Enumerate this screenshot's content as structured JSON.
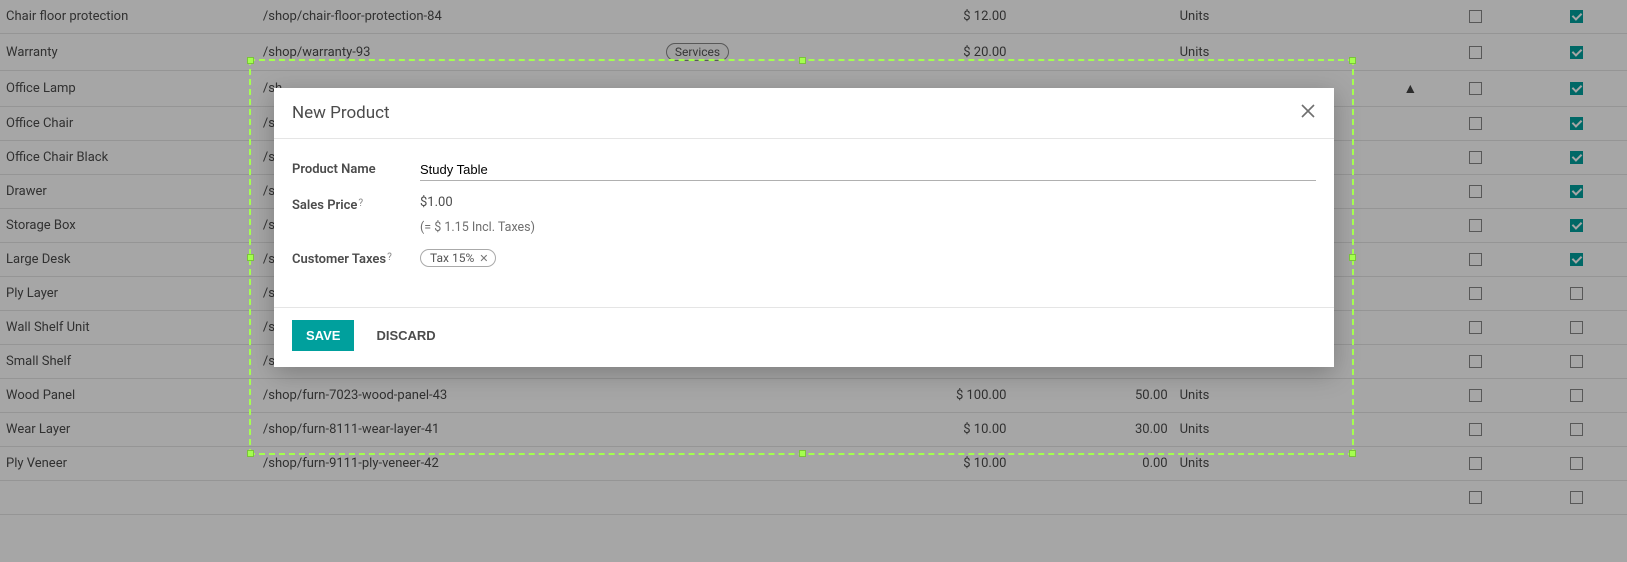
{
  "modal": {
    "title": "New Product",
    "fields": {
      "product_name_label": "Product Name",
      "product_name_value": "Study Table",
      "sales_price_label": "Sales Price",
      "sales_price_value": "$1.00",
      "sales_price_incl": "(= $ 1.15 Incl. Taxes)",
      "customer_taxes_label": "Customer Taxes",
      "tax_tag": "Tax 15%"
    },
    "buttons": {
      "save": "SAVE",
      "discard": "DISCARD"
    }
  },
  "table": {
    "rows": [
      {
        "name": "Chair floor protection",
        "url": "/shop/chair-floor-protection-84",
        "tag": "",
        "price": "$ 12.00",
        "qty": "",
        "units": "Units",
        "warn": false,
        "cb1": false,
        "cb2": true
      },
      {
        "name": "Warranty",
        "url": "/shop/warranty-93",
        "tag": "Services",
        "price": "$ 20.00",
        "qty": "",
        "units": "Units",
        "warn": false,
        "cb1": false,
        "cb2": true
      },
      {
        "name": "Office Lamp",
        "url": "/sh",
        "tag": "",
        "price": "",
        "qty": "",
        "units": "",
        "warn": true,
        "cb1": false,
        "cb2": true
      },
      {
        "name": "Office Chair",
        "url": "/sh",
        "tag": "",
        "price": "",
        "qty": "",
        "units": "",
        "warn": false,
        "cb1": false,
        "cb2": true
      },
      {
        "name": "Office Chair Black",
        "url": "/sh",
        "tag": "",
        "price": "",
        "qty": "",
        "units": "",
        "warn": false,
        "cb1": false,
        "cb2": true
      },
      {
        "name": "Drawer",
        "url": "/sh",
        "tag": "",
        "price": "",
        "qty": "",
        "units": "",
        "warn": false,
        "cb1": false,
        "cb2": true
      },
      {
        "name": "Storage Box",
        "url": "/sh",
        "tag": "",
        "price": "",
        "qty": "",
        "units": "",
        "warn": false,
        "cb1": false,
        "cb2": true
      },
      {
        "name": "Large Desk",
        "url": "/sh",
        "tag": "",
        "price": "",
        "qty": "",
        "units": "",
        "warn": false,
        "cb1": false,
        "cb2": true
      },
      {
        "name": "Ply Layer",
        "url": "/sh",
        "tag": "",
        "price": "",
        "qty": "",
        "units": "",
        "warn": false,
        "cb1": false,
        "cb2": false
      },
      {
        "name": "Wall Shelf Unit",
        "url": "/sh",
        "tag": "",
        "price": "",
        "qty": "",
        "units": "",
        "warn": false,
        "cb1": false,
        "cb2": false
      },
      {
        "name": "Small Shelf",
        "url": "/sh",
        "tag": "",
        "price": "",
        "qty": "",
        "units": "",
        "warn": false,
        "cb1": false,
        "cb2": false
      },
      {
        "name": "Wood Panel",
        "url": "/shop/furn-7023-wood-panel-43",
        "tag": "",
        "price": "$ 100.00",
        "qty": "50.00",
        "units": "Units",
        "warn": false,
        "cb1": false,
        "cb2": false
      },
      {
        "name": "Wear Layer",
        "url": "/shop/furn-8111-wear-layer-41",
        "tag": "",
        "price": "$ 10.00",
        "qty": "30.00",
        "units": "Units",
        "warn": false,
        "cb1": false,
        "cb2": false
      },
      {
        "name": "Ply Veneer",
        "url": "/shop/furn-9111-ply-veneer-42",
        "tag": "",
        "price": "$ 10.00",
        "qty": "0.00",
        "units": "Units",
        "warn": false,
        "cb1": false,
        "cb2": false
      },
      {
        "name": "",
        "url": "",
        "tag": "",
        "price": "",
        "qty": "",
        "units": "",
        "warn": false,
        "cb1": false,
        "cb2": false
      }
    ]
  }
}
